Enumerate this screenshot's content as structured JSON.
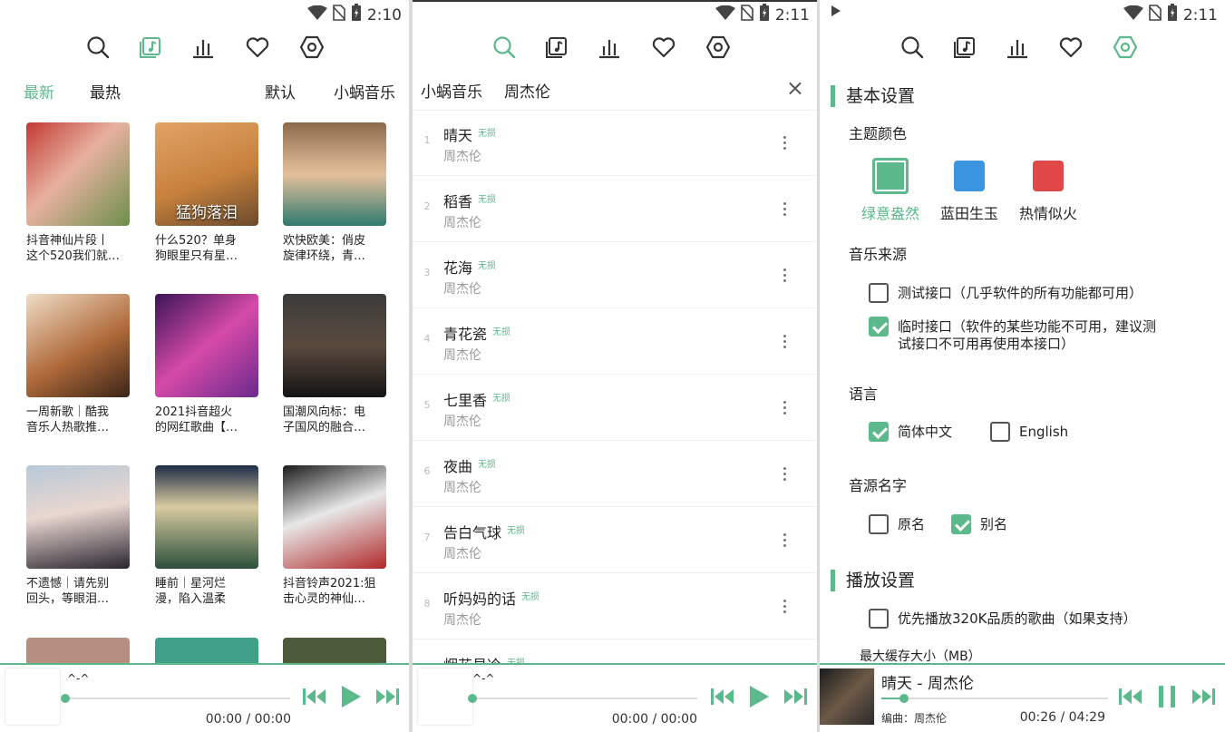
{
  "status": {
    "time_1": "2:10",
    "time_2": "2:11",
    "time_3": "2:11"
  },
  "colors": {
    "accent": "#5bb98c",
    "blue": "#3b95e0",
    "red": "#e04848"
  },
  "tabs": [
    "search-icon",
    "music-folder-icon",
    "chart-bars-icon",
    "heart-icon",
    "settings-icon"
  ],
  "discover": {
    "cats_left": [
      "最新",
      "最热"
    ],
    "cats_right": [
      "默认",
      "小蜗音乐"
    ],
    "playlists": [
      {
        "line1": "抖音神仙片段丨",
        "line2": "这个520我们就…",
        "overlay": ""
      },
      {
        "line1": "什么520？单身",
        "line2": "狗眼里只有星…",
        "overlay": "猛狗落泪"
      },
      {
        "line1": "欢快欧美：俏皮",
        "line2": "旋律环绕，青…",
        "overlay": ""
      },
      {
        "line1": "一周新歌｜酷我",
        "line2": "音乐人热歌推…",
        "overlay": ""
      },
      {
        "line1": "2021抖音超火",
        "line2": "的网红歌曲【…",
        "overlay": ""
      },
      {
        "line1": "国潮风向标：电",
        "line2": "子国风的融合…",
        "overlay": ""
      },
      {
        "line1": "不遗憾｜请先别",
        "line2": "回头，等眼泪…",
        "overlay": ""
      },
      {
        "line1": "睡前｜星河烂",
        "line2": "漫，陷入温柔",
        "overlay": ""
      },
      {
        "line1": "抖音铃声2021:狙",
        "line2": "击心灵的神仙…",
        "overlay": ""
      }
    ]
  },
  "search": {
    "source": "小蜗音乐",
    "query": "周杰伦",
    "close": "×",
    "songs": [
      {
        "num": "1",
        "title": "晴天",
        "badge": "无损",
        "artist": "周杰伦"
      },
      {
        "num": "2",
        "title": "稻香",
        "badge": "无损",
        "artist": "周杰伦"
      },
      {
        "num": "3",
        "title": "花海",
        "badge": "无损",
        "artist": "周杰伦"
      },
      {
        "num": "4",
        "title": "青花瓷",
        "badge": "无损",
        "artist": "周杰伦"
      },
      {
        "num": "5",
        "title": "七里香",
        "badge": "无损",
        "artist": "周杰伦"
      },
      {
        "num": "6",
        "title": "夜曲",
        "badge": "无损",
        "artist": "周杰伦"
      },
      {
        "num": "7",
        "title": "告白气球",
        "badge": "无损",
        "artist": "周杰伦"
      },
      {
        "num": "8",
        "title": "听妈妈的话",
        "badge": "无损",
        "artist": "周杰伦"
      },
      {
        "num": "",
        "title": "烟花易冷",
        "badge": "无损",
        "artist": ""
      }
    ]
  },
  "settings": {
    "basic": "基本设置",
    "theme_label": "主题颜色",
    "themes": [
      "绿意盎然",
      "蓝田生玉",
      "热情似火"
    ],
    "source_label": "音乐来源",
    "source_opt1": "测试接口（几乎软件的所有功能都可用）",
    "source_opt2a": "临时接口（软件的某些功能不可用，建议测",
    "source_opt2b": "试接口不可用再使用本接口）",
    "lang_label": "语言",
    "lang_zh": "简体中文",
    "lang_en": "English",
    "name_label": "音源名字",
    "name_orig": "原名",
    "name_alias": "别名",
    "play": "播放设置",
    "play_opt": "优先播放320K品质的歌曲（如果支持）",
    "cache": "最大缓存大小（MB）",
    "checked": {
      "source_opt1": false,
      "source_opt2": true,
      "lang_zh": true,
      "lang_en": false,
      "name_orig": false,
      "name_alias": true,
      "play_opt": false
    }
  },
  "player1": {
    "title": "^-^",
    "time": "00:00 / 00:00",
    "progress": 0
  },
  "player2": {
    "title": "^-^",
    "time": "00:00 / 00:00",
    "progress": 0
  },
  "player3": {
    "title": "晴天 - 周杰伦",
    "subtitle": "编曲：周杰伦",
    "time": "00:26 / 04:29",
    "progress": 0.1
  }
}
